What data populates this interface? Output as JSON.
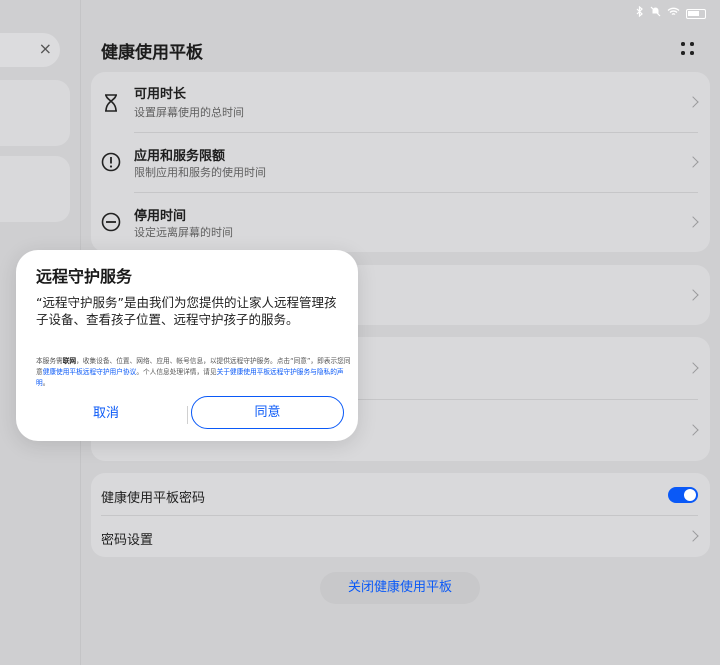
{
  "status_bar": {
    "icons": [
      "bluetooth-icon",
      "silent-icon",
      "wifi-icon",
      "battery-icon"
    ]
  },
  "sidebar": {
    "close_symbol": "×"
  },
  "header": {
    "title": "健康使用平板"
  },
  "settings": {
    "items": [
      {
        "title": "可用时长",
        "subtitle": "设置屏幕使用的总时间",
        "icon": "hourglass-icon"
      },
      {
        "title": "应用和服务限额",
        "subtitle": "限制应用和服务的使用时间",
        "icon": "alert-circle-icon"
      },
      {
        "title": "停用时间",
        "subtitle": "设定远离屏幕的时间",
        "icon": "minus-circle-icon"
      }
    ],
    "password_section": {
      "toggle_label": "健康使用平板密码",
      "toggle_on": true,
      "password_settings": "密码设置"
    },
    "close_button": "关闭健康使用平板"
  },
  "dialog": {
    "title": "远程守护服务",
    "body": "“远程守护服务”是由我们为您提供的让家人远程管理孩子设备、查看孩子位置、远程守护孩子的服务。",
    "notice": {
      "part1": "本服务需",
      "bold1": "联网",
      "part2": "，收集设备、位置、网络、应用、帐号信息，以提供远程守护服务。点击“同意”，即表示您同意",
      "link1": "健康使用平板远程守护用户协议",
      "part3": "。个人信息处理详情，请见",
      "link2": "关于健康使用平板远程守护服务与隐私的声明",
      "part4": "。"
    },
    "cancel_label": "取消",
    "agree_label": "同意"
  },
  "colors": {
    "accent": "#0a59f7",
    "background": "#cfcfd1",
    "card": "#d9d9db",
    "dialog": "#ffffff"
  }
}
